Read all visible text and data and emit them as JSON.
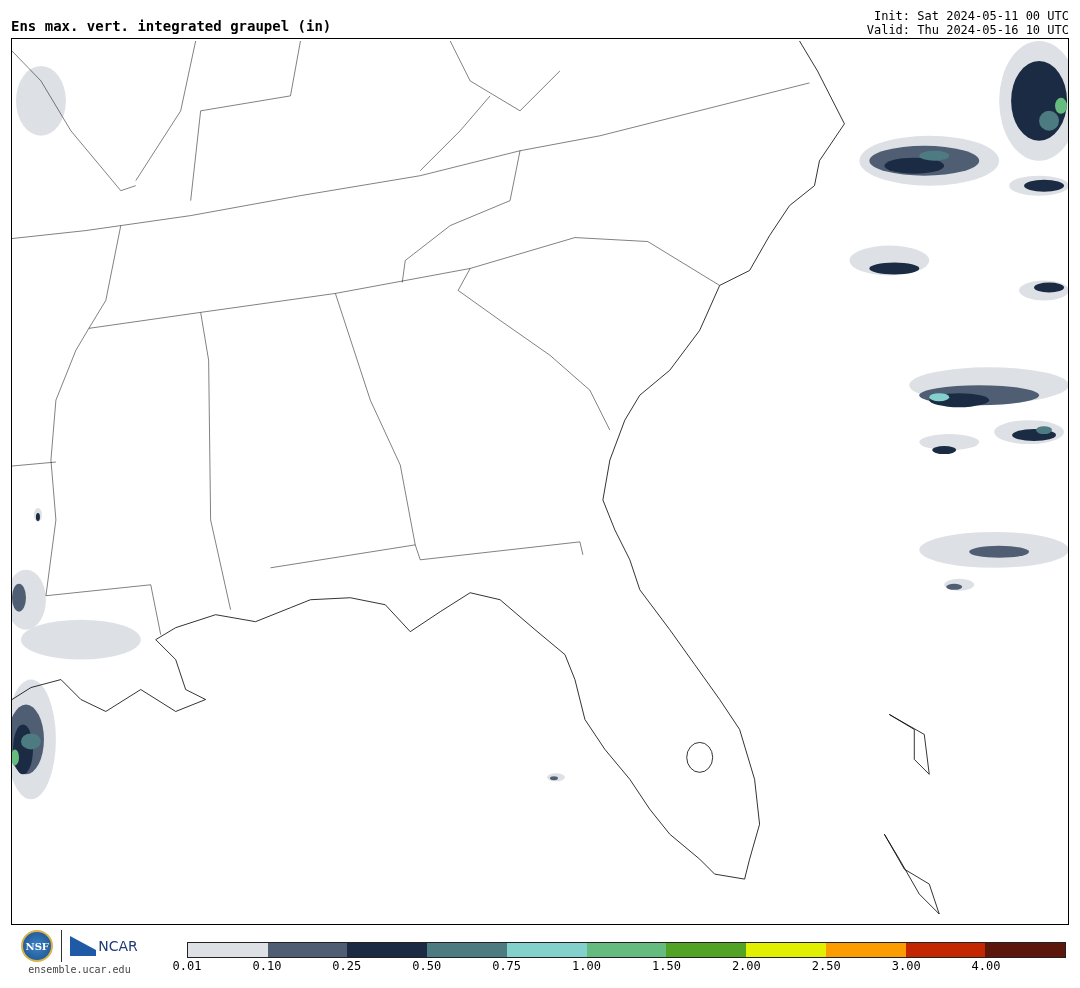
{
  "header": {
    "title": "Ens max. vert. integrated graupel (in)",
    "init": "Init: Sat 2024-05-11 00 UTC",
    "valid": "Valid: Thu 2024-05-16 10 UTC"
  },
  "footer": {
    "nsf_logo": "NSF",
    "ncar_logo": "NCAR",
    "url": "ensemble.ucar.edu"
  },
  "colorbar": {
    "segments": [
      {
        "color": "#dde1e5"
      },
      {
        "color": "#505e74"
      },
      {
        "color": "#1b2b43"
      },
      {
        "color": "#4c7c82"
      },
      {
        "color": "#84d0cc"
      },
      {
        "color": "#66bb7e"
      },
      {
        "color": "#52a325"
      },
      {
        "color": "#e0f000"
      },
      {
        "color": "#fb9c00"
      },
      {
        "color": "#c42600"
      },
      {
        "color": "#5c160c"
      }
    ],
    "labels": [
      "0.01",
      "0.10",
      "0.25",
      "0.50",
      "0.75",
      "1.00",
      "1.50",
      "2.00",
      "2.50",
      "3.00",
      "4.00"
    ]
  }
}
